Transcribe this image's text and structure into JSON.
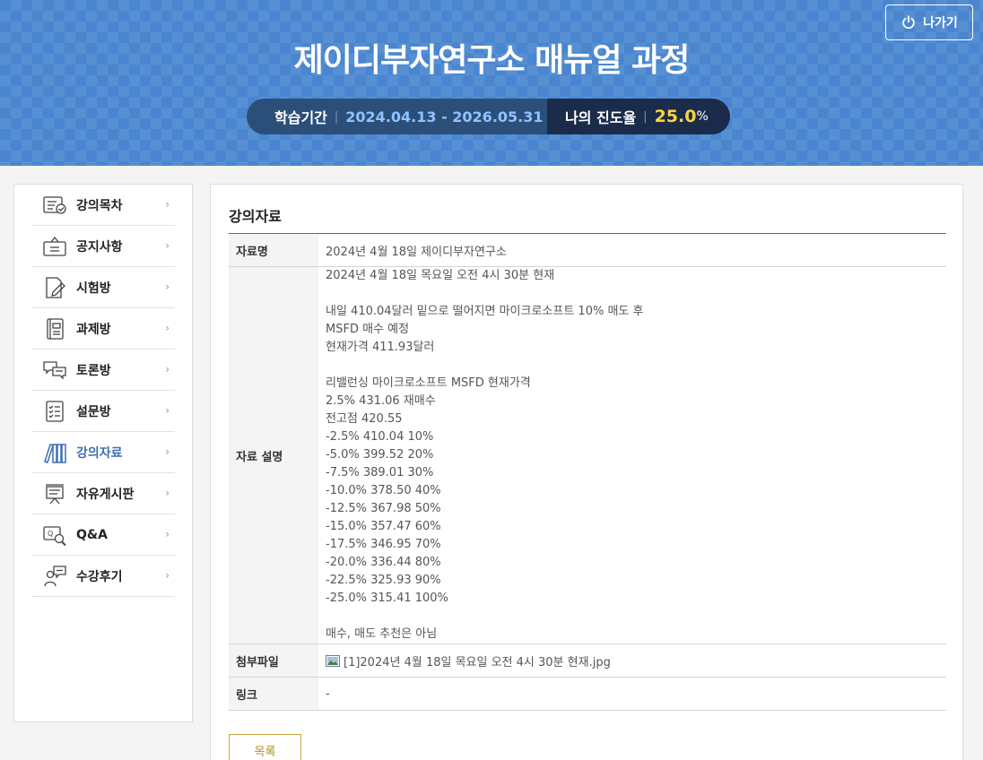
{
  "header": {
    "exit_label": "나가기",
    "course_title": "제이디부자연구소 매뉴얼 과정",
    "period_label": "학습기간",
    "period_dates": "2024.04.13 - 2026.05.31",
    "progress_label": "나의 진도율",
    "progress_value": "25.0",
    "progress_unit": "%"
  },
  "sidebar": {
    "items": [
      {
        "label": "강의목차",
        "icon": "lecture-index-icon"
      },
      {
        "label": "공지사항",
        "icon": "notice-icon"
      },
      {
        "label": "시험방",
        "icon": "exam-icon"
      },
      {
        "label": "과제방",
        "icon": "assignment-icon"
      },
      {
        "label": "토론방",
        "icon": "discussion-icon"
      },
      {
        "label": "설문방",
        "icon": "survey-icon"
      },
      {
        "label": "강의자료",
        "icon": "materials-icon"
      },
      {
        "label": "자유게시판",
        "icon": "free-board-icon"
      },
      {
        "label": "Q&A",
        "icon": "qna-icon"
      },
      {
        "label": "수강후기",
        "icon": "review-icon"
      }
    ],
    "active_index": 6
  },
  "main": {
    "section_title": "강의자료",
    "labels": {
      "name": "자료명",
      "description": "자료 설명",
      "attachment": "첨부파일",
      "link": "링크"
    },
    "name_value": "2024년 4월 18일 제이디부자연구소",
    "description_lines": [
      "2024년 4월 18일 목요일 오전 4시 30분 현재",
      "",
      "내일 410.04달러 밑으로 떨어지면 마이크로소프트 10% 매도 후",
      "MSFD 매수 예정",
      "현재가격 411.93달러",
      "",
      "리밸런싱 마이크로소프트 MSFD 현재가격",
      "2.5% 431.06 재매수",
      "전고점 420.55",
      "-2.5% 410.04 10%",
      "-5.0% 399.52 20%",
      "-7.5% 389.01 30%",
      "-10.0% 378.50 40%",
      "-12.5% 367.98 50%",
      "-15.0% 357.47 60%",
      "-17.5% 346.95 70%",
      "-20.0% 336.44 80%",
      "-22.5% 325.93 90%",
      "-25.0% 315.41 100%",
      "",
      "매수, 매도 추천은 아님"
    ],
    "attachment_name": "[1]2024년 4월 18일 목요일 오전 4시 30분 현재.jpg",
    "link_value": "-",
    "list_button_label": "목록"
  },
  "colors": {
    "header_bg": "#4a86d0",
    "active_menu": "#3e6fb0",
    "progress_value": "#ffd23e",
    "dates": "#8fc3ff"
  }
}
